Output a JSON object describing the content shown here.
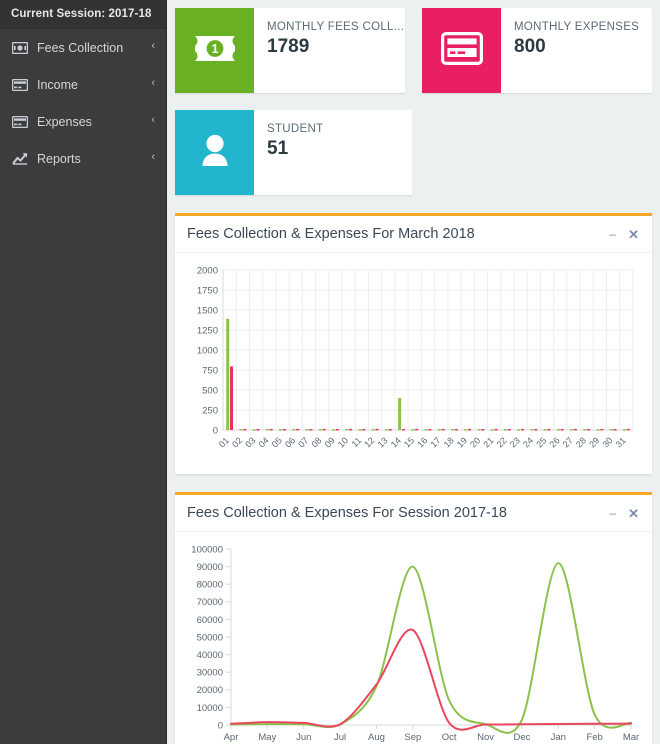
{
  "sidebar": {
    "session_label": "Current Session: 2017-18",
    "items": [
      {
        "label": "Fees Collection",
        "icon": "money-icon",
        "caret": "‹"
      },
      {
        "label": "Income",
        "icon": "card-icon",
        "caret": "‹"
      },
      {
        "label": "Expenses",
        "icon": "card-icon",
        "caret": "‹"
      },
      {
        "label": "Reports",
        "icon": "chart-icon",
        "caret": "‹"
      }
    ]
  },
  "cards": [
    {
      "title": "MONTHLY FEES COLL...",
      "value": "1789",
      "color": "#6ab023",
      "icon": "banknote-icon"
    },
    {
      "title": "MONTHLY EXPENSES",
      "value": "800",
      "color": "#e91e63",
      "icon": "credit-card-icon"
    },
    {
      "title": "STUDENT",
      "value": "51",
      "color": "#21b6ce",
      "icon": "user-icon"
    }
  ],
  "panels": [
    {
      "title": "Fees Collection & Expenses For March 2018",
      "minimize": "–",
      "close": "✕"
    },
    {
      "title": "Fees Collection & Expenses For Session 2017-18",
      "minimize": "–",
      "close": "✕"
    }
  ],
  "chart_data": [
    {
      "type": "bar",
      "title": "Fees Collection & Expenses For March 2018",
      "xlabel": "",
      "ylabel": "",
      "ylim": [
        0,
        2000
      ],
      "yticks": [
        0,
        250,
        500,
        750,
        1000,
        1250,
        1500,
        1750,
        2000
      ],
      "grid": true,
      "legend": "none",
      "categories": [
        "01",
        "02",
        "03",
        "04",
        "05",
        "06",
        "07",
        "08",
        "09",
        "10",
        "11",
        "12",
        "13",
        "14",
        "15",
        "16",
        "17",
        "18",
        "19",
        "20",
        "21",
        "22",
        "23",
        "24",
        "25",
        "26",
        "27",
        "28",
        "29",
        "30",
        "31"
      ],
      "series": [
        {
          "name": "Fees Collection",
          "color": "#8bc34a",
          "values": [
            1390,
            12,
            10,
            12,
            10,
            12,
            10,
            12,
            10,
            12,
            10,
            12,
            10,
            400,
            10,
            12,
            10,
            12,
            10,
            12,
            10,
            12,
            10,
            12,
            10,
            12,
            10,
            12,
            10,
            12,
            10
          ]
        },
        {
          "name": "Expenses",
          "color": "#e8335a",
          "values": [
            795,
            14,
            12,
            14,
            12,
            14,
            12,
            14,
            12,
            14,
            12,
            14,
            12,
            12,
            14,
            12,
            14,
            12,
            14,
            12,
            14,
            12,
            14,
            12,
            14,
            12,
            14,
            12,
            14,
            12,
            14
          ]
        }
      ]
    },
    {
      "type": "line",
      "title": "Fees Collection & Expenses For Session 2017-18",
      "xlabel": "",
      "ylabel": "",
      "ylim": [
        0,
        100000
      ],
      "yticks": [
        0,
        10000,
        20000,
        30000,
        40000,
        50000,
        60000,
        70000,
        80000,
        90000,
        100000
      ],
      "grid": true,
      "legend": "none",
      "categories": [
        "Apr",
        "May",
        "Jun",
        "Jul",
        "Aug",
        "Sep",
        "Oct",
        "Nov",
        "Dec",
        "Jan",
        "Feb",
        "Mar"
      ],
      "series": [
        {
          "name": "Fees Collection",
          "color": "#8bc34a",
          "values": [
            300,
            500,
            400,
            300,
            22000,
            90000,
            14000,
            500,
            3000,
            92000,
            6000,
            1200
          ]
        },
        {
          "name": "Expenses",
          "color": "#e8475f",
          "values": [
            700,
            1600,
            1200,
            400,
            23000,
            54000,
            1200,
            300,
            400,
            600,
            700,
            800
          ]
        }
      ]
    }
  ]
}
